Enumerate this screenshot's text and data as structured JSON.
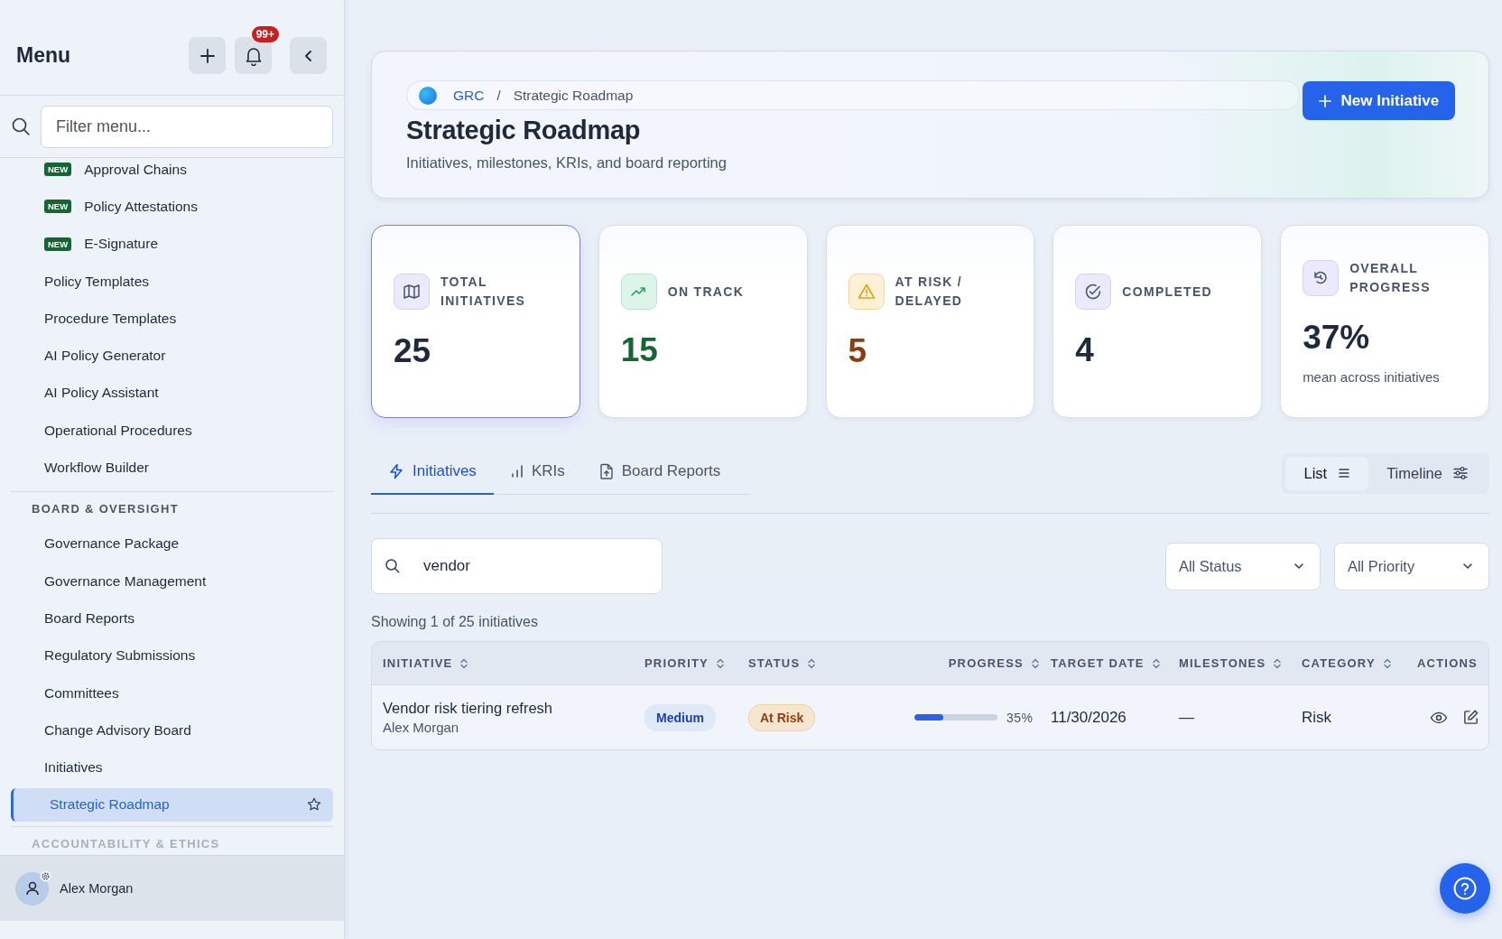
{
  "sidebar": {
    "title": "Menu",
    "notification_badge": "99+",
    "filter": {
      "placeholder": "Filter menu..."
    },
    "items": [
      {
        "kind": "item",
        "label": "Approval Chains",
        "badge": "NEW",
        "selected": false
      },
      {
        "kind": "item",
        "label": "Policy Attestations",
        "badge": "NEW",
        "selected": false
      },
      {
        "kind": "item",
        "label": "E-Signature",
        "badge": "NEW",
        "selected": false
      },
      {
        "kind": "item",
        "label": "Policy Templates",
        "selected": false
      },
      {
        "kind": "item",
        "label": "Procedure Templates",
        "selected": false
      },
      {
        "kind": "item",
        "label": "AI Policy Generator",
        "selected": false
      },
      {
        "kind": "item",
        "label": "AI Policy Assistant",
        "selected": false
      },
      {
        "kind": "item",
        "label": "Operational Procedures",
        "selected": false
      },
      {
        "kind": "item",
        "label": "Workflow Builder",
        "selected": false
      },
      {
        "kind": "section",
        "label": "BOARD & OVERSIGHT",
        "faded": false
      },
      {
        "kind": "item",
        "label": "Governance Package",
        "selected": false
      },
      {
        "kind": "item",
        "label": "Governance Management",
        "selected": false
      },
      {
        "kind": "item",
        "label": "Board Reports",
        "selected": false
      },
      {
        "kind": "item",
        "label": "Regulatory Submissions",
        "selected": false
      },
      {
        "kind": "item",
        "label": "Committees",
        "selected": false
      },
      {
        "kind": "item",
        "label": "Change Advisory Board",
        "selected": false
      },
      {
        "kind": "item",
        "label": "Initiatives",
        "selected": false
      },
      {
        "kind": "item",
        "label": "Strategic Roadmap",
        "selected": true
      },
      {
        "kind": "section",
        "label": "ACCOUNTABILITY & ETHICS",
        "faded": true
      }
    ],
    "user": {
      "name": "Alex Morgan"
    }
  },
  "header": {
    "breadcrumb": [
      "GRC",
      "Strategic Roadmap"
    ],
    "separator": "/",
    "title": "Strategic Roadmap",
    "subtitle": "Initiatives, milestones, KRIs, and board reporting",
    "action": "New Initiative"
  },
  "stats": [
    {
      "kind": "total",
      "label": "TOTAL INITIATIVES",
      "value": "25",
      "selected": true
    },
    {
      "kind": "on_track",
      "label": "ON TRACK",
      "value": "15",
      "selected": false
    },
    {
      "kind": "at_risk",
      "label": "AT RISK / DELAYED",
      "value": "5",
      "selected": false
    },
    {
      "kind": "completed",
      "label": "COMPLETED",
      "value": "4",
      "selected": false
    },
    {
      "kind": "progress",
      "label": "OVERALL PROGRESS",
      "value": "37%",
      "note": "mean across initiatives",
      "selected": false
    }
  ],
  "tabs": [
    {
      "kind": "bolt",
      "label": "Initiatives",
      "selected": true
    },
    {
      "kind": "bars",
      "label": "KRIs",
      "selected": false
    },
    {
      "kind": "file",
      "label": "Board Reports",
      "selected": false
    }
  ],
  "views": [
    {
      "kind": "list",
      "label": "List",
      "selected": true
    },
    {
      "kind": "timeline",
      "label": "Timeline",
      "selected": false
    }
  ],
  "search": {
    "value": "vendor"
  },
  "filters": [
    "All Status",
    "All Priority"
  ],
  "count": "Showing 1 of 25 initiatives",
  "table": {
    "columns": [
      {
        "label": "INITIATIVE",
        "sortable": true
      },
      {
        "label": "PRIORITY",
        "sortable": true
      },
      {
        "label": "STATUS",
        "sortable": true
      },
      {
        "label": "PROGRESS",
        "sortable": true
      },
      {
        "label": "TARGET DATE",
        "sortable": true
      },
      {
        "label": "MILESTONES",
        "sortable": true
      },
      {
        "label": "CATEGORY",
        "sortable": true
      },
      {
        "label": "ACTIONS",
        "sortable": false
      }
    ],
    "rows": [
      {
        "title": "Vendor risk tiering refresh",
        "owner": "Alex Morgan",
        "priority": {
          "label": "Medium",
          "kind": "medium"
        },
        "status": {
          "label": "At Risk",
          "kind": "at_risk"
        },
        "level": 0.35,
        "progress": "35%",
        "target_date": "11/30/2026",
        "milestones": "—",
        "category": "Risk"
      }
    ]
  }
}
